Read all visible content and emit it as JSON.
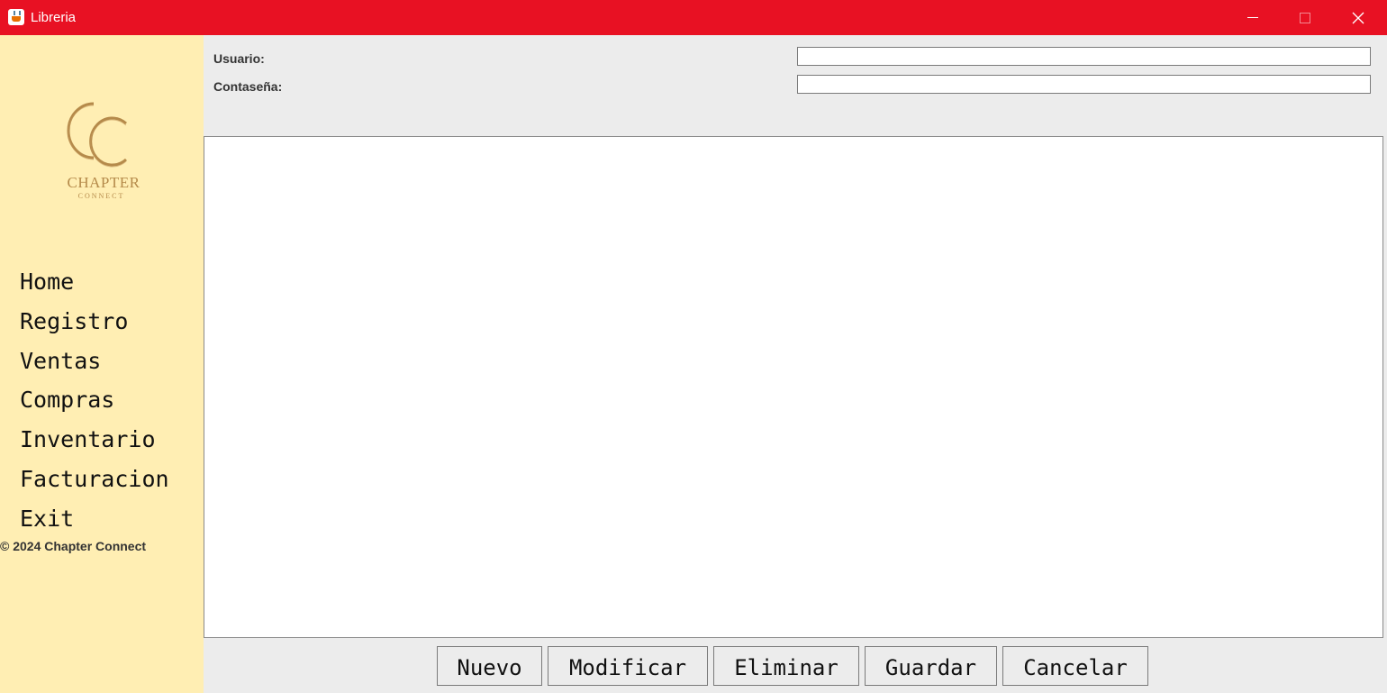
{
  "window": {
    "title": "Libreria",
    "accent_color": "#e81123",
    "controls": [
      "minimize-icon",
      "maximize-icon",
      "close-icon"
    ]
  },
  "sidebar": {
    "background": "#ffeeb3",
    "logo": {
      "monogram": "CC",
      "name": "CHAPTER",
      "subtitle": "CONNECT",
      "color": "#b58a4a"
    },
    "items": [
      {
        "label": "Home"
      },
      {
        "label": "Registro"
      },
      {
        "label": "Ventas"
      },
      {
        "label": "Compras"
      },
      {
        "label": "Inventario"
      },
      {
        "label": "Facturacion"
      },
      {
        "label": "Exit"
      }
    ],
    "copyright": "© 2024 Chapter Connect"
  },
  "form": {
    "user_label": "Usuario:",
    "user_value": "",
    "password_label": "Contaseña:",
    "password_value": ""
  },
  "actions": {
    "nuevo": "Nuevo",
    "modificar": "Modificar",
    "eliminar": "Eliminar",
    "guardar": "Guardar",
    "cancelar": "Cancelar"
  }
}
